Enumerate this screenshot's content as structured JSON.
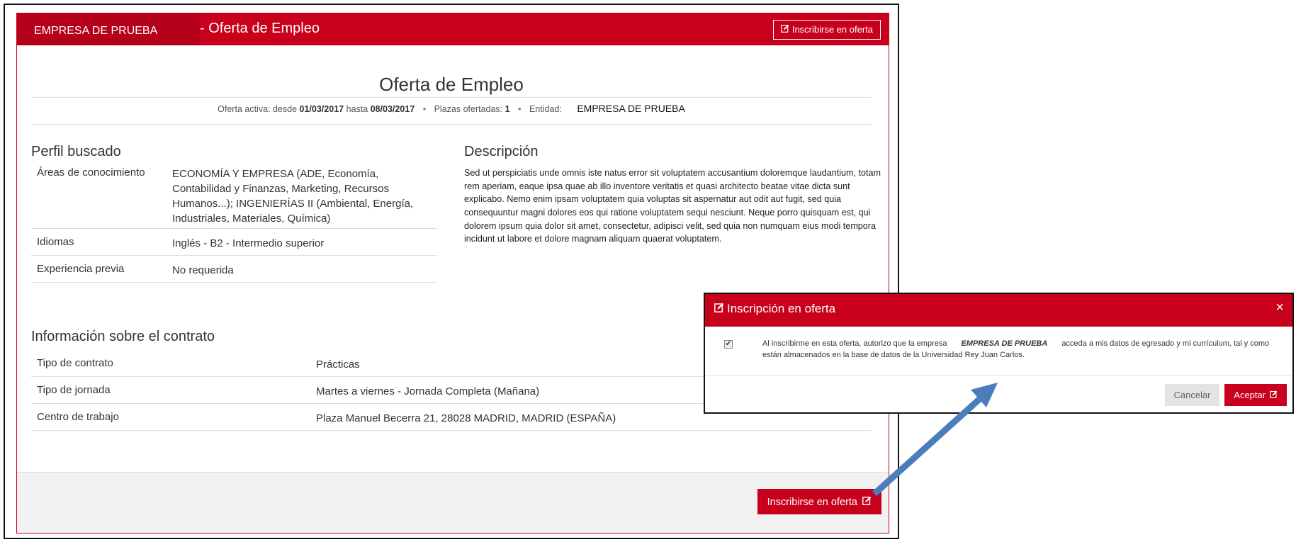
{
  "header": {
    "company": "EMPRESA DE PRUEBA",
    "title": "- Oferta de Empleo",
    "inscribe_button": "Inscribirse en oferta",
    "inscribe_icon": "edit-icon"
  },
  "offer": {
    "page_title": "Oferta de Empleo",
    "active_label": "Oferta activa:",
    "from_label": "desde",
    "from_date": "01/03/2017",
    "to_label": "hasta",
    "to_date": "08/03/2017",
    "vacancies_label": "Plazas ofertadas:",
    "vacancies": "1",
    "entity_label": "Entidad:",
    "entity": "EMPRESA DE PRUEBA",
    "separator": "•"
  },
  "profile": {
    "title": "Perfil buscado",
    "rows": [
      {
        "label": "Áreas de conocimiento",
        "value": "ECONOMÍA Y EMPRESA (ADE, Economía, Contabilidad y Finanzas, Marketing, Recursos Humanos...); INGENIERÍAS II (Ambiental, Energía, Industriales, Materiales, Química)"
      },
      {
        "label": "Idiomas",
        "value": "Inglés - B2 - Intermedio superior"
      },
      {
        "label": "Experiencia previa",
        "value": "No requerida"
      }
    ]
  },
  "description": {
    "title": "Descripción",
    "text": "Sed ut perspiciatis unde omnis iste natus error sit voluptatem accusantium doloremque laudantium, totam rem aperiam, eaque ipsa quae ab illo inventore veritatis et quasi architecto beatae vitae dicta sunt explicabo. Nemo enim ipsam voluptatem quia voluptas sit aspernatur aut odit aut fugit, sed quia consequuntur magni dolores eos qui ratione voluptatem sequi nesciunt. Neque porro quisquam est, qui dolorem ipsum quia dolor sit amet, consectetur, adipisci velit, sed quia non numquam eius modi tempora incidunt ut labore et dolore magnam aliquam quaerat voluptatem."
  },
  "contract": {
    "title": "Información sobre el contrato",
    "rows": [
      {
        "label": "Tipo de contrato",
        "value": "Prácticas"
      },
      {
        "label": "Tipo de jornada",
        "value": "Martes a viernes - Jornada Completa (Mañana)"
      },
      {
        "label": "Centro de trabajo",
        "value": "Plaza Manuel Becerra 21, 28028 MADRID, MADRID (ESPAÑA)"
      }
    ]
  },
  "footer": {
    "inscribe_button": "Inscribirse en oferta",
    "inscribe_icon": "edit-icon"
  },
  "modal": {
    "title": "Inscripción en oferta",
    "title_icon": "edit-icon",
    "close": "×",
    "checkbox_checked": true,
    "checkbox_glyph": "✔",
    "text_before": "Al inscribirme en esta oferta, autorizo que la empresa",
    "company": "EMPRESA DE PRUEBA",
    "text_after": "acceda a mis datos de egresado y mi currículum, tal y como están almacenados en la base de datos de la Universidad Rey Juan Carlos.",
    "cancel": "Cancelar",
    "accept": "Aceptar",
    "accept_icon": "edit-icon"
  },
  "colors": {
    "brand_red": "#c8001c",
    "arrow_blue": "#4a7ebb"
  }
}
